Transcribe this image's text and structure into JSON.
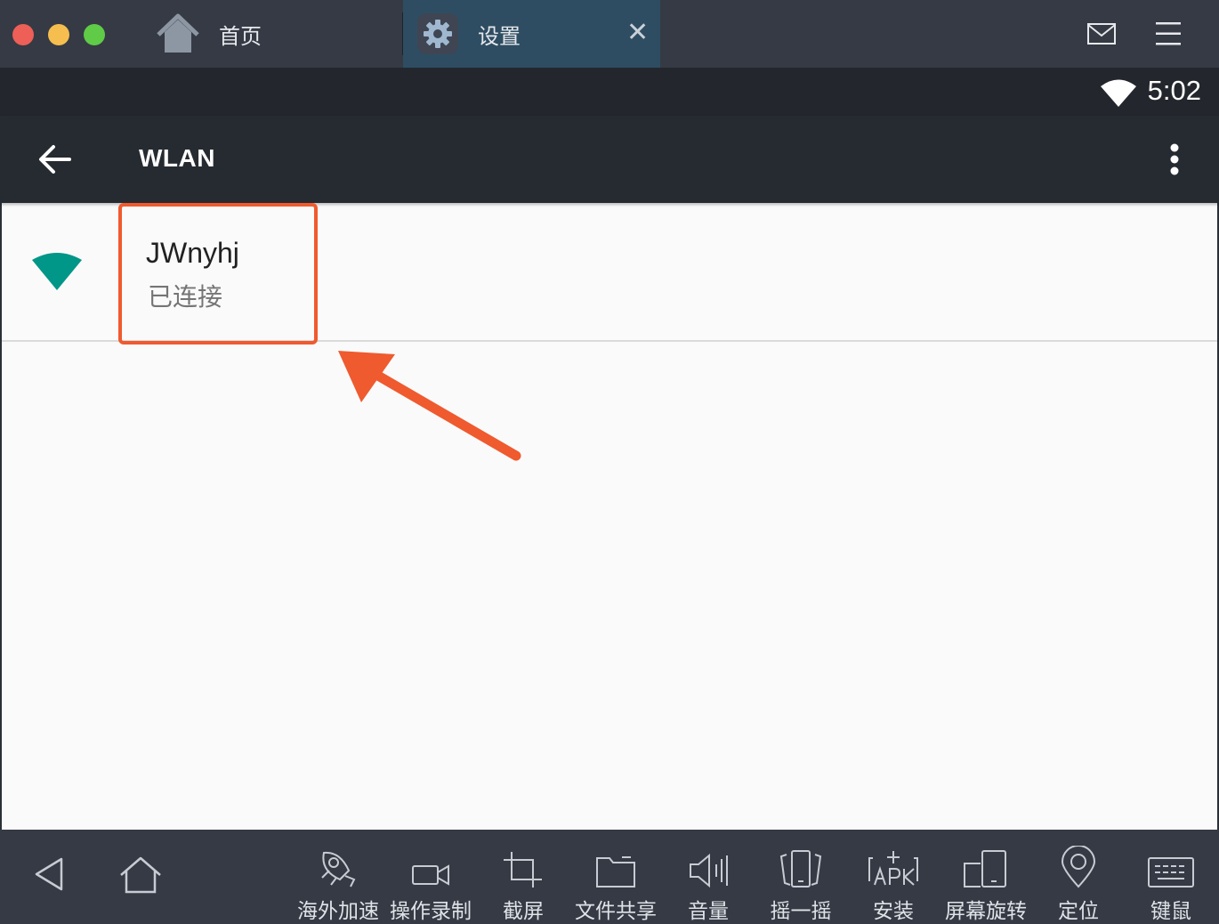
{
  "titlebar": {
    "tabs": [
      {
        "label": "首页",
        "icon": "home-icon",
        "active": false
      },
      {
        "label": "设置",
        "icon": "gear-icon",
        "active": true,
        "close_glyph": "✕"
      }
    ],
    "right_icons": [
      "mail-icon",
      "menu-icon"
    ]
  },
  "statusbar": {
    "time": "5:02",
    "wifi_icon": "wifi-icon"
  },
  "appbar": {
    "title": "WLAN",
    "back_icon": "arrow-left-icon",
    "overflow_icon": "more-vert-icon"
  },
  "wifi_list": [
    {
      "name": "JWnyhj",
      "status": "已连接",
      "signal_icon": "wifi-signal-icon"
    }
  ],
  "toolbar": {
    "nav": [
      "back-triangle-icon",
      "home-outline-icon"
    ],
    "tools": [
      {
        "label": "海外加速",
        "icon": "rocket-icon"
      },
      {
        "label": "操作录制",
        "icon": "video-camera-icon"
      },
      {
        "label": "截屏",
        "icon": "crop-icon"
      },
      {
        "label": "文件共享",
        "icon": "folder-icon"
      },
      {
        "label": "音量",
        "icon": "volume-icon"
      },
      {
        "label": "摇一摇",
        "icon": "shake-phone-icon"
      },
      {
        "label": "安装",
        "icon": "apk-install-icon"
      },
      {
        "label": "屏幕旋转",
        "icon": "screen-rotate-icon"
      },
      {
        "label": "定位",
        "icon": "location-pin-icon"
      },
      {
        "label": "键鼠",
        "icon": "keyboard-icon"
      }
    ]
  },
  "colors": {
    "annotation": "#ef5a2f",
    "wifi_signal": "#009688",
    "active_tab": "#2e4d62",
    "appbar": "#262b32"
  }
}
